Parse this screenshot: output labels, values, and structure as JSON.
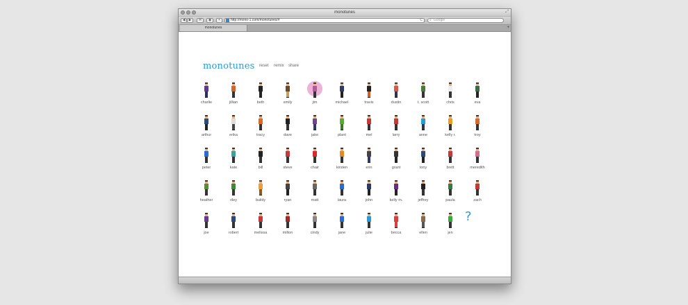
{
  "window": {
    "title": "monotunes"
  },
  "toolbar": {
    "url": "http://mono-1.com/monotunes/#",
    "search_placeholder": "Google",
    "back_label": "◀",
    "forward_label": "▶",
    "add_label": "+",
    "reload_label": "C"
  },
  "tab": {
    "label": "monotunes"
  },
  "page": {
    "logo": "monotunes",
    "nav": [
      "reset",
      "remix",
      "share"
    ],
    "question_mark": "?"
  },
  "colors": {
    "accent": "#2a9bd6"
  },
  "people": [
    {
      "name": "charlie",
      "shirt": "#5b3a8a",
      "pants": "#2b2b6a"
    },
    {
      "name": "jillian",
      "shirt": "#d4642c",
      "pants": "#333"
    },
    {
      "name": "beth",
      "shirt": "#222",
      "pants": "#222"
    },
    {
      "name": "emily",
      "shirt": "#6b4a2a",
      "pants": "#c4a060"
    },
    {
      "name": "jim",
      "shirt": "#b05c9a",
      "pants": "#333"
    },
    {
      "name": "michael",
      "shirt": "#2d3a6a",
      "pants": "#222"
    },
    {
      "name": "travis",
      "shirt": "#222",
      "pants": "#d85a2a"
    },
    {
      "name": "dustin",
      "shirt": "#d35a4a",
      "pants": "#334"
    },
    {
      "name": "t. scott",
      "shirt": "#4a7a3a",
      "pants": "#333"
    },
    {
      "name": "chris",
      "shirt": "#eee",
      "pants": "#333"
    },
    {
      "name": "eva",
      "shirt": "#3a6a4a",
      "pants": "#222"
    },
    {
      "name": "arthur",
      "shirt": "#2b4a7a",
      "pants": "#222"
    },
    {
      "name": "erika",
      "shirt": "#ddd",
      "pants": "#444"
    },
    {
      "name": "tracy",
      "shirt": "#d86a2a",
      "pants": "#333"
    },
    {
      "name": "dave",
      "shirt": "#222",
      "pants": "#333"
    },
    {
      "name": "jake",
      "shirt": "#6a4a8a",
      "pants": "#2b3a6a"
    },
    {
      "name": "plant",
      "shirt": "#5aaa3a",
      "pants": "#3a7a2a"
    },
    {
      "name": "mel",
      "shirt": "#c43a3a",
      "pants": "#333"
    },
    {
      "name": "larry",
      "shirt": "#c43a3a",
      "pants": "#333"
    },
    {
      "name": "anne",
      "shirt": "#2a9bd6",
      "pants": "#334"
    },
    {
      "name": "kelly r.",
      "shirt": "#e8a020",
      "pants": "#333"
    },
    {
      "name": "troy",
      "shirt": "#d86a2a",
      "pants": "#333"
    },
    {
      "name": "peter",
      "shirt": "#2a6ad6",
      "pants": "#333"
    },
    {
      "name": "kate",
      "shirt": "#3aa0a0",
      "pants": "#333"
    },
    {
      "name": "bill",
      "shirt": "#222",
      "pants": "#333"
    },
    {
      "name": "steve",
      "shirt": "#c43a3a",
      "pants": "#333"
    },
    {
      "name": "chair",
      "shirt": "#d82a2a",
      "pants": "#333"
    },
    {
      "name": "kirsten",
      "shirt": "#e88a20",
      "pants": "#333"
    },
    {
      "name": "erin",
      "shirt": "#444",
      "pants": "#2b3a6a"
    },
    {
      "name": "grant",
      "shirt": "#333",
      "pants": "#222"
    },
    {
      "name": "tony",
      "shirt": "#2b4a7a",
      "pants": "#222"
    },
    {
      "name": "brett",
      "shirt": "#c43a3a",
      "pants": "#333"
    },
    {
      "name": "meredith",
      "shirt": "#d86a8a",
      "pants": "#333"
    },
    {
      "name": "heather",
      "shirt": "#5a8a3a",
      "pants": "#333"
    },
    {
      "name": "riley",
      "shirt": "#3a8a3a",
      "pants": "#333"
    },
    {
      "name": "buildy",
      "shirt": "#e8a040",
      "pants": "#8a5a2a"
    },
    {
      "name": "ryan",
      "shirt": "#444",
      "pants": "#222"
    },
    {
      "name": "matt",
      "shirt": "#666",
      "pants": "#333"
    },
    {
      "name": "laura",
      "shirt": "#2a6ad6",
      "pants": "#333"
    },
    {
      "name": "john",
      "shirt": "#2b3a6a",
      "pants": "#222"
    },
    {
      "name": "kelly m.",
      "shirt": "#6a2a8a",
      "pants": "#222"
    },
    {
      "name": "jeffrey",
      "shirt": "#222",
      "pants": "#333"
    },
    {
      "name": "paula",
      "shirt": "#3a7a4a",
      "pants": "#333"
    },
    {
      "name": "zach",
      "shirt": "#c43a3a",
      "pants": "#333"
    },
    {
      "name": "joe",
      "shirt": "#6a3a8a",
      "pants": "#333"
    },
    {
      "name": "robert",
      "shirt": "#2b4a7a",
      "pants": "#333"
    },
    {
      "name": "melissa",
      "shirt": "#c43a3a",
      "pants": "#333"
    },
    {
      "name": "milton",
      "shirt": "#a02a2a",
      "pants": "#333"
    },
    {
      "name": "cindy",
      "shirt": "#888",
      "pants": "#333"
    },
    {
      "name": "jane",
      "shirt": "#2a6ad6",
      "pants": "#333"
    },
    {
      "name": "julie",
      "shirt": "#2a9bd6",
      "pants": "#333"
    },
    {
      "name": "becca",
      "shirt": "#d84040",
      "pants": "#d84040"
    },
    {
      "name": "ellen",
      "shirt": "#8a6a4a",
      "pants": "#555"
    },
    {
      "name": "jen",
      "shirt": "#3aaa3a",
      "pants": "#333"
    }
  ]
}
